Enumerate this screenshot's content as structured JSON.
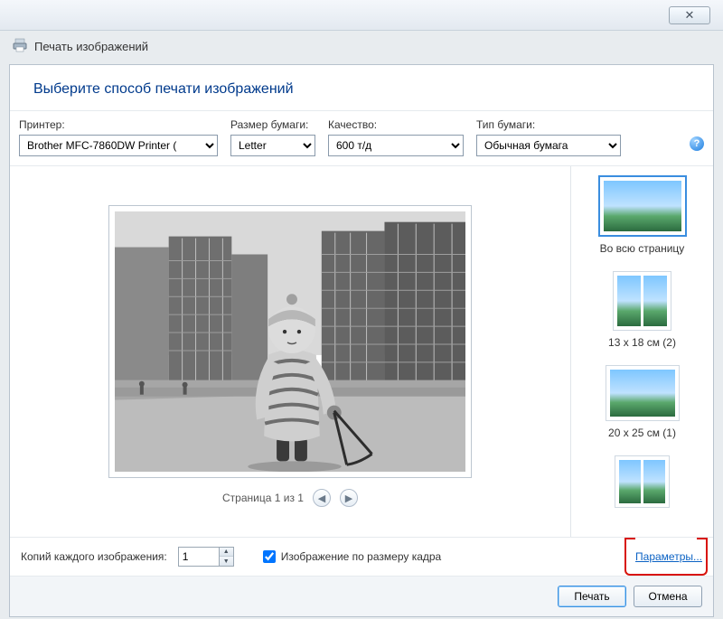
{
  "window": {
    "title": "Печать изображений"
  },
  "heading": "Выберите способ печати изображений",
  "options": {
    "printer": {
      "label": "Принтер:",
      "value": "Brother MFC-7860DW Printer ("
    },
    "paper_size": {
      "label": "Размер бумаги:",
      "value": "Letter"
    },
    "quality": {
      "label": "Качество:",
      "value": "600 т/д"
    },
    "paper_type": {
      "label": "Тип бумаги:",
      "value": "Обычная бумага"
    }
  },
  "pager": {
    "text": "Страница 1 из 1"
  },
  "layouts": [
    {
      "label": "Во всю страницу",
      "selected": true,
      "cols": 1
    },
    {
      "label": "13 x 18 см (2)",
      "selected": false,
      "cols": 2
    },
    {
      "label": "20 x 25 см (1)",
      "selected": false,
      "cols": 1
    },
    {
      "label": "",
      "selected": false,
      "cols": 2
    }
  ],
  "bottom": {
    "copies_label": "Копий каждого изображения:",
    "copies_value": "1",
    "fit_label": "Изображение по размеру кадра",
    "fit_checked": true,
    "params_link": "Параметры..."
  },
  "footer": {
    "print": "Печать",
    "cancel": "Отмена"
  }
}
